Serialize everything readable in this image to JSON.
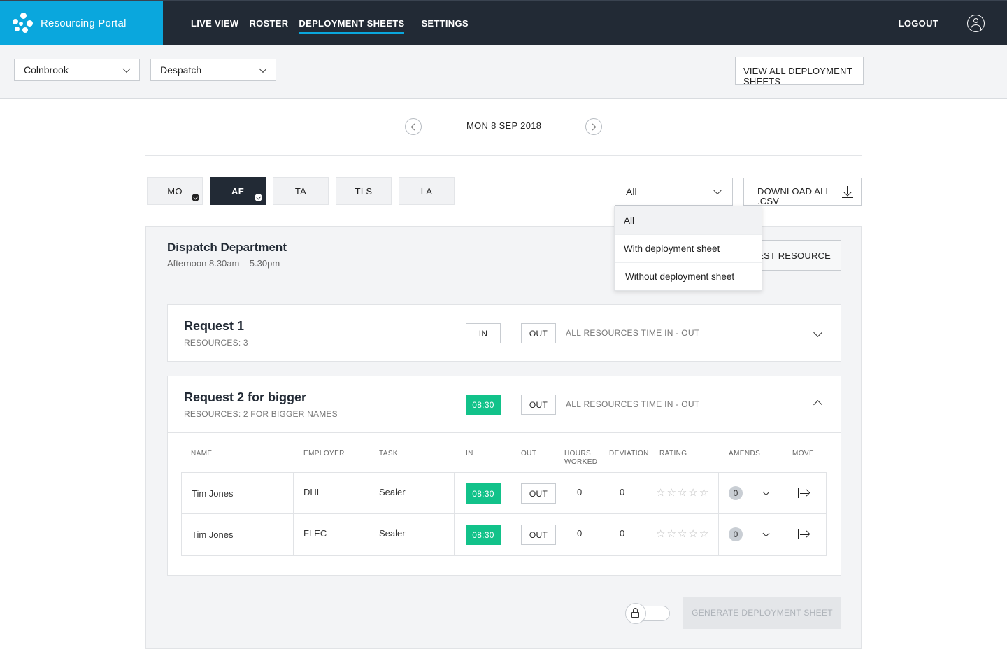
{
  "app": {
    "title": "Resourcing Portal"
  },
  "nav": {
    "items": [
      {
        "label": "LIVE VIEW"
      },
      {
        "label": "ROSTER"
      },
      {
        "label": "DEPLOYMENT SHEETS",
        "active": true
      },
      {
        "label": "SETTINGS"
      }
    ],
    "logout": "LOGOUT"
  },
  "filters": {
    "site": "Colnbrook",
    "department": "Despatch",
    "view_all_label": "VIEW ALL DEPLOYMENT SHEETS"
  },
  "date": {
    "label": "MON 8 SEP 2018"
  },
  "shifts": [
    {
      "label": "MO",
      "checked": true,
      "active": false
    },
    {
      "label": "AF",
      "checked": true,
      "active": true
    },
    {
      "label": "TA",
      "checked": false,
      "active": false
    },
    {
      "label": "TLS",
      "checked": false,
      "active": false
    },
    {
      "label": "LA",
      "checked": false,
      "active": false
    }
  ],
  "sheet_filter": {
    "selected": "All",
    "options": [
      "All",
      "With deployment sheet",
      "Without deployment sheet"
    ]
  },
  "download_label": "DOWNLOAD ALL .CSV",
  "department": {
    "title": "Dispatch Department",
    "subtitle": "Afternoon 8.30am – 5.30pm",
    "request_resource_label": "REQUEST RESOURCE"
  },
  "requests": [
    {
      "title": "Request 1",
      "resources": "RESOURCES: 3",
      "in_label": "IN",
      "out_label": "OUT",
      "all_resources_label": "ALL RESOURCES TIME IN - OUT",
      "expanded": false
    },
    {
      "title": "Request 2 for bigger",
      "resources": "RESOURCES: 2 FOR BIGGER NAMES",
      "in_label": "08:30",
      "out_label": "OUT",
      "all_resources_label": "ALL RESOURCES TIME IN - OUT",
      "expanded": true,
      "columns": {
        "name": "NAME",
        "employer": "EMPLOYER",
        "task": "TASK",
        "in": "IN",
        "out": "OUT",
        "hours_worked": "HOURS WORKED",
        "deviation": "DEVIATION",
        "rating": "RATING",
        "amends": "AMENDS",
        "move": "MOVE"
      },
      "rows": [
        {
          "name": "Tim Jones",
          "employer": "DHL",
          "task": "Sealer",
          "in": "08:30",
          "out": "OUT",
          "hours": "0",
          "deviation": "0",
          "rating": 0,
          "amends": "0"
        },
        {
          "name": "Tim Jones",
          "employer": "FLEC",
          "task": "Sealer",
          "in": "08:30",
          "out": "OUT",
          "hours": "0",
          "deviation": "0",
          "rating": 0,
          "amends": "0"
        }
      ]
    }
  ],
  "footer": {
    "generate_label": "GENERATE DEPLOYMENT SHEET"
  },
  "colors": {
    "brand": "#0aa7dd",
    "header_bg": "#222a35",
    "success": "#12c28a",
    "panel_bg": "#f3f4f6"
  }
}
